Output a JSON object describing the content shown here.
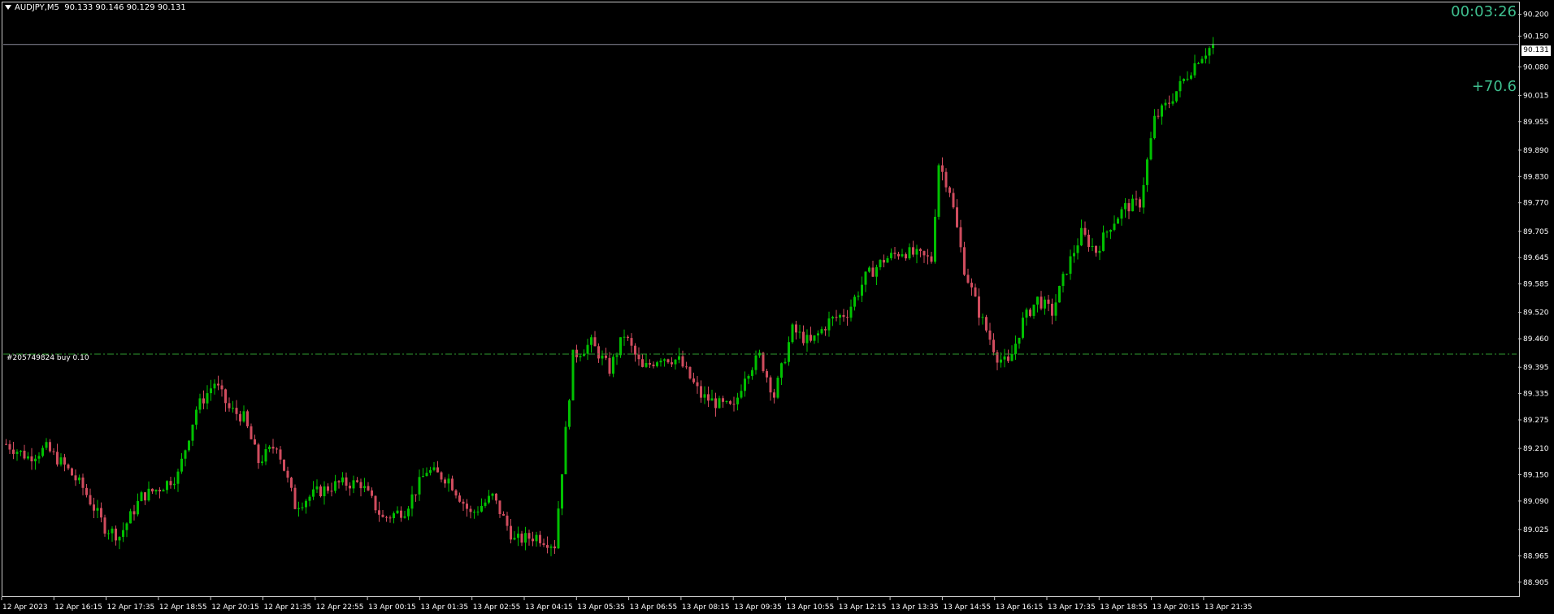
{
  "header": {
    "symbol": "AUDJPY,M5",
    "ohlc": "90.133 90.146 90.129 90.131"
  },
  "countdown": "00:03:26",
  "profit": "+70.6",
  "current_price_label": "90.131",
  "order": {
    "label": "#205749824 buy 0.10",
    "price": 89.425
  },
  "colors": {
    "background": "#000000",
    "bull": "#00c000",
    "bear": "#d04c5e",
    "order_line": "#2f9a2f",
    "bid_line": "#8a8a9a",
    "overlay_text": "#3fbf8f"
  },
  "chart_data": {
    "type": "candlestick",
    "ylim": [
      88.875,
      90.225
    ],
    "y_ticks": [
      "90.200",
      "90.150",
      "90.080",
      "90.015",
      "89.955",
      "89.890",
      "89.830",
      "89.770",
      "89.705",
      "89.645",
      "89.585",
      "89.520",
      "89.460",
      "89.395",
      "89.335",
      "89.275",
      "89.210",
      "89.150",
      "89.090",
      "89.025",
      "88.965",
      "88.905"
    ],
    "x_ticks": [
      "12 Apr 2023",
      "12 Apr 16:15",
      "12 Apr 17:35",
      "12 Apr 18:55",
      "12 Apr 20:15",
      "12 Apr 21:35",
      "12 Apr 22:55",
      "13 Apr 00:15",
      "13 Apr 01:35",
      "13 Apr 02:55",
      "13 Apr 04:15",
      "13 Apr 05:35",
      "13 Apr 06:55",
      "13 Apr 08:15",
      "13 Apr 09:35",
      "13 Apr 10:55",
      "13 Apr 12:15",
      "13 Apr 13:35",
      "13 Apr 14:55",
      "13 Apr 16:15",
      "13 Apr 17:35",
      "13 Apr 18:55",
      "13 Apr 20:15",
      "13 Apr 21:35"
    ],
    "bid": 90.131,
    "close_path": [
      [
        0,
        89.22
      ],
      [
        6,
        89.19
      ],
      [
        11,
        89.21
      ],
      [
        16,
        89.17
      ],
      [
        21,
        89.12
      ],
      [
        27,
        89.03
      ],
      [
        31,
        89.01
      ],
      [
        37,
        89.1
      ],
      [
        42,
        89.12
      ],
      [
        47,
        89.15
      ],
      [
        52,
        89.3
      ],
      [
        57,
        89.36
      ],
      [
        61,
        89.3
      ],
      [
        65,
        89.28
      ],
      [
        69,
        89.18
      ],
      [
        74,
        89.22
      ],
      [
        79,
        89.08
      ],
      [
        85,
        89.11
      ],
      [
        91,
        89.13
      ],
      [
        97,
        89.13
      ],
      [
        103,
        89.05
      ],
      [
        109,
        89.07
      ],
      [
        115,
        89.16
      ],
      [
        121,
        89.14
      ],
      [
        127,
        89.06
      ],
      [
        133,
        89.1
      ],
      [
        139,
        89.0
      ],
      [
        145,
        89.01
      ],
      [
        150,
        88.99
      ],
      [
        155,
        89.42
      ],
      [
        160,
        89.45
      ],
      [
        165,
        89.39
      ],
      [
        169,
        89.47
      ],
      [
        174,
        89.39
      ],
      [
        179,
        89.42
      ],
      [
        184,
        89.41
      ],
      [
        190,
        89.33
      ],
      [
        195,
        89.31
      ],
      [
        199,
        89.3
      ],
      [
        202,
        89.38
      ],
      [
        206,
        89.42
      ],
      [
        210,
        89.33
      ],
      [
        215,
        89.48
      ],
      [
        220,
        89.45
      ],
      [
        225,
        89.5
      ],
      [
        230,
        89.52
      ],
      [
        235,
        89.6
      ],
      [
        240,
        89.64
      ],
      [
        245,
        89.66
      ],
      [
        249,
        89.65
      ],
      [
        253,
        89.64
      ],
      [
        255,
        89.86
      ],
      [
        258,
        89.8
      ],
      [
        262,
        89.62
      ],
      [
        266,
        89.52
      ],
      [
        271,
        89.42
      ],
      [
        274,
        89.4
      ],
      [
        278,
        89.5
      ],
      [
        282,
        89.55
      ],
      [
        286,
        89.52
      ],
      [
        290,
        89.62
      ],
      [
        294,
        89.7
      ],
      [
        298,
        89.66
      ],
      [
        302,
        89.72
      ],
      [
        306,
        89.76
      ],
      [
        310,
        89.77
      ],
      [
        314,
        89.96
      ],
      [
        318,
        90.0
      ],
      [
        322,
        90.05
      ],
      [
        326,
        90.1
      ],
      [
        330,
        90.13
      ]
    ],
    "num_candles": 331
  }
}
